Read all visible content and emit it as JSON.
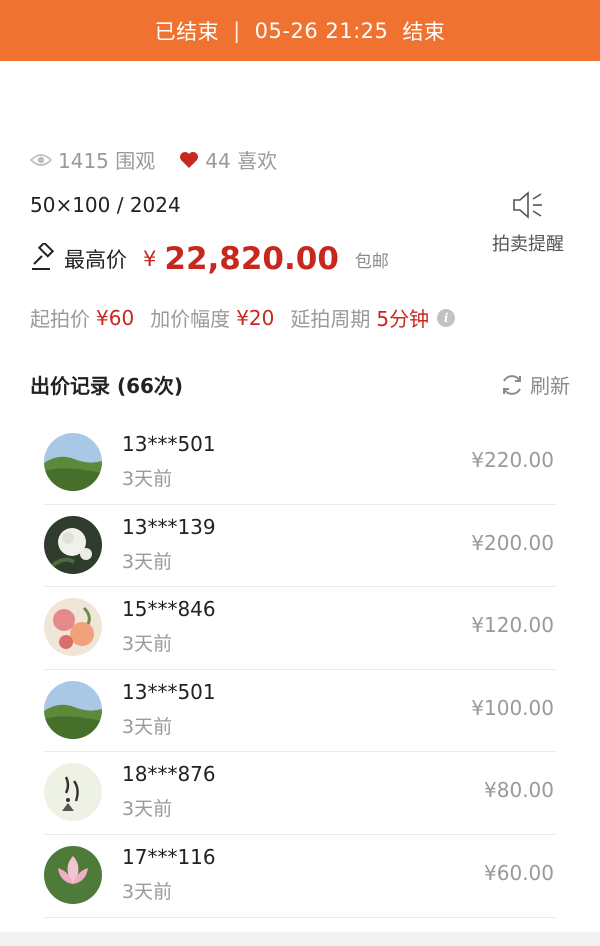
{
  "banner": {
    "status": "已结束",
    "date_time": "05-26 21:25",
    "end_label": "结束"
  },
  "stats": {
    "views": "1415 围观",
    "likes": "44 喜欢"
  },
  "spec": "50×100 / 2024",
  "price": {
    "label": "最高价",
    "currency": "¥",
    "amount": "22,820.00",
    "shipping": "包邮"
  },
  "reminder": {
    "label": "拍卖提醒",
    "icon": "speaker-icon"
  },
  "rules": {
    "start_label": "起拍价",
    "start_value": "¥60",
    "increment_label": "加价幅度",
    "increment_value": "¥20",
    "extend_label": "延拍周期",
    "extend_value": "5分钟",
    "info_glyph": "i"
  },
  "bids": {
    "title": "出价记录 (66次)",
    "refresh_label": "刷新",
    "rows": [
      {
        "user": "13***501",
        "time": "3天前",
        "amount": "¥220.00",
        "avatar": "landscape"
      },
      {
        "user": "13***139",
        "time": "3天前",
        "amount": "¥200.00",
        "avatar": "white-rose"
      },
      {
        "user": "15***846",
        "time": "3天前",
        "amount": "¥120.00",
        "avatar": "flower-painting"
      },
      {
        "user": "13***501",
        "time": "3天前",
        "amount": "¥100.00",
        "avatar": "landscape"
      },
      {
        "user": "18***876",
        "time": "3天前",
        "amount": "¥80.00",
        "avatar": "ink-calligraphy"
      },
      {
        "user": "17***116",
        "time": "3天前",
        "amount": "¥60.00",
        "avatar": "lotus"
      }
    ]
  },
  "colors": {
    "banner": "#ef7230",
    "price_red": "#c7281e",
    "muted": "#9a9a9a"
  }
}
